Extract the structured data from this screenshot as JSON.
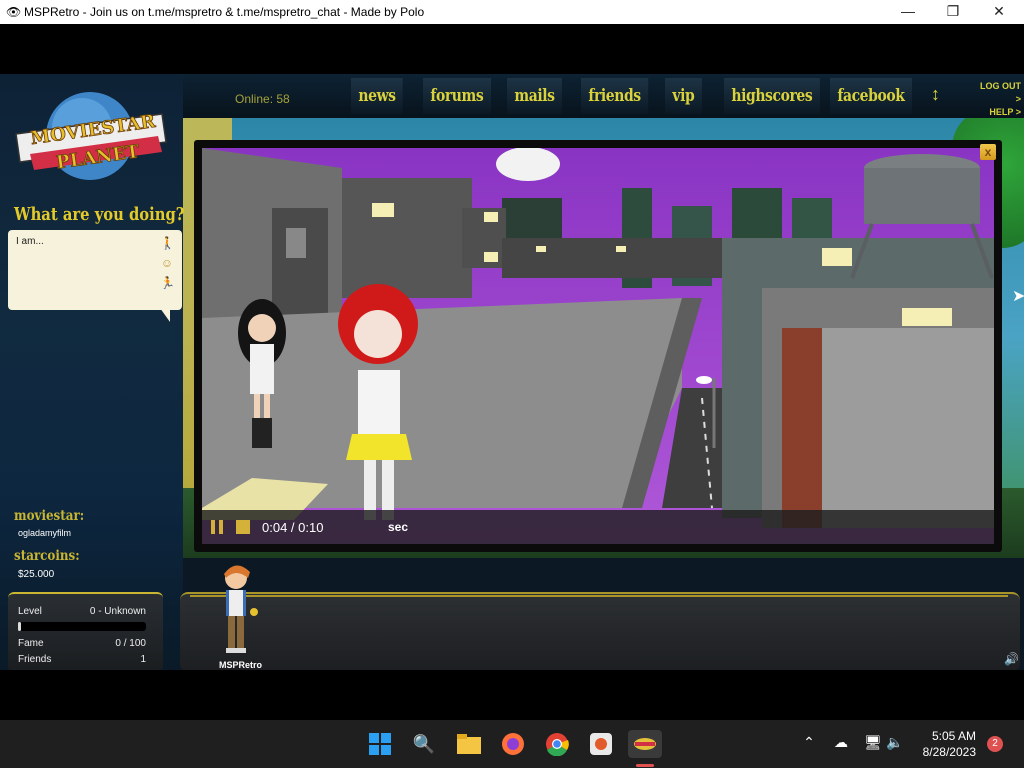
{
  "window": {
    "title": "MSPRetro - Join us on t.me/mspretro & t.me/mspretro_chat - Made by Polo",
    "minimize": "—",
    "maximize": "❐",
    "close": "✕"
  },
  "nav": {
    "online": "Online: 58",
    "items": [
      "news",
      "forums",
      "mails",
      "friends",
      "vip",
      "highscores",
      "facebook"
    ],
    "logout": "LOG OUT >",
    "help": "HELP >"
  },
  "logo": {
    "line1": "MOVIESTAR",
    "line2": "PLANET"
  },
  "status": {
    "question": "What are you doing?",
    "text": "I am..."
  },
  "profile": {
    "moviestar_label": "moviestar:",
    "username": "ogladamyfilm",
    "starcoins_label": "starcoins:",
    "starcoins": "$25.000",
    "level_label": "Level",
    "level_value": "0 - Unknown",
    "level_progress": 0.02,
    "fame_label": "Fame",
    "fame_value": "0 / 100",
    "friends_label": "Friends",
    "friends_value": "1"
  },
  "player": {
    "time": "0:04 / 0:10",
    "suffix": "sec",
    "close": "x"
  },
  "chat": {
    "avatar_name": "MSPRetro"
  },
  "taskbar": {
    "time": "5:05 AM",
    "date": "8/28/2023",
    "notifications": "2"
  }
}
